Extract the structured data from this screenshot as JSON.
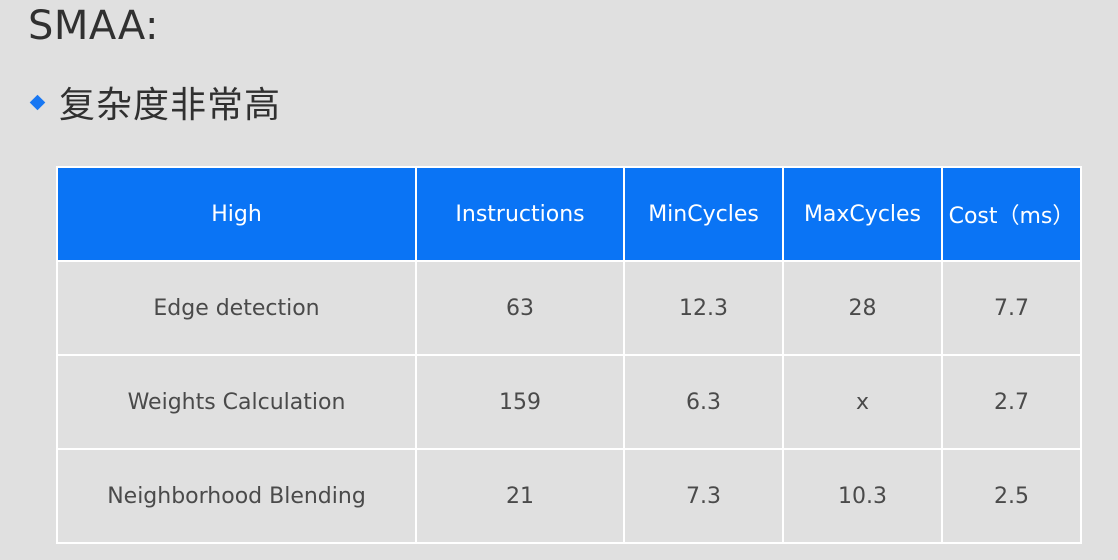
{
  "slide": {
    "title": "SMAA:",
    "bullet": "复杂度非常高"
  },
  "colors": {
    "accent": "#0a74f5",
    "background": "#e0e0e0"
  },
  "table": {
    "headers": [
      "High",
      "Instructions",
      "MinCycles",
      "MaxCycles",
      "Cost（ms）"
    ],
    "rows": [
      [
        "Edge detection",
        "63",
        "12.3",
        "28",
        "7.7"
      ],
      [
        "Weights Calculation",
        "159",
        "6.3",
        "x",
        "2.7"
      ],
      [
        "Neighborhood Blending",
        "21",
        "7.3",
        "10.3",
        "2.5"
      ]
    ]
  }
}
